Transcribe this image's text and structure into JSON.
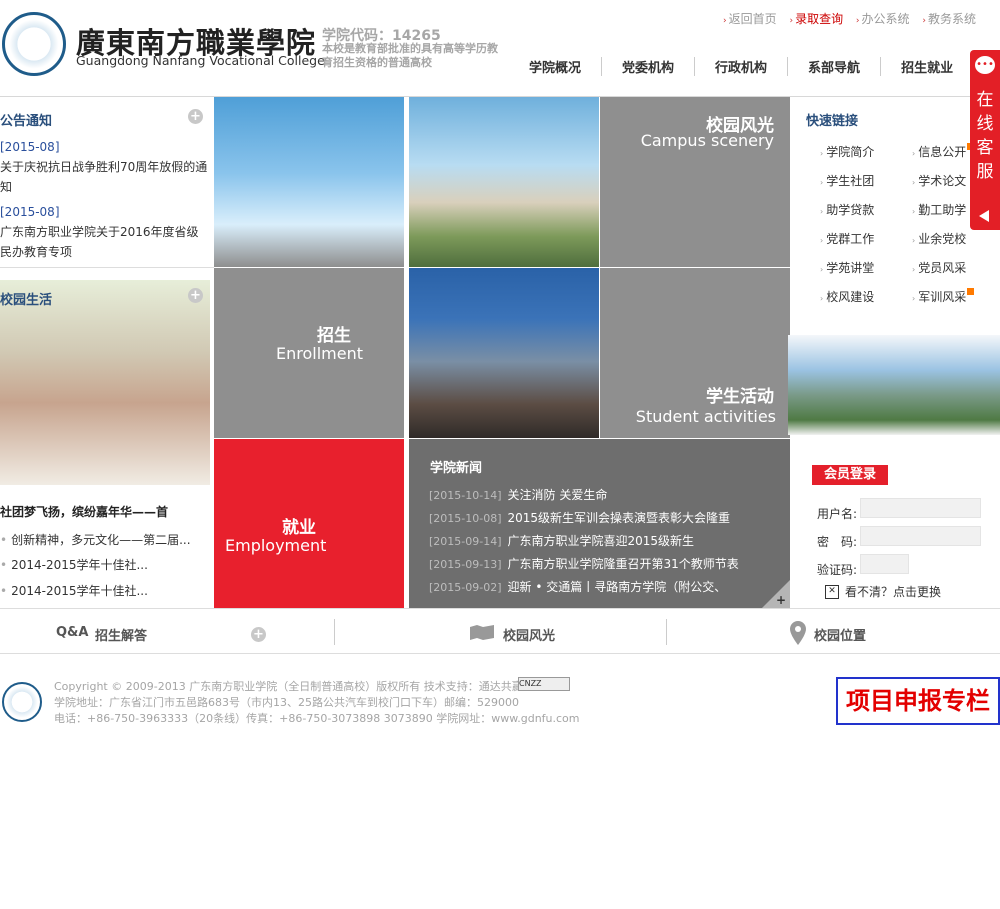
{
  "header": {
    "logo_cn": "廣東南方職業學院",
    "logo_en": "Guangdong Nanfang Vocational College",
    "school_code": "学院代码：14265",
    "school_desc": "本校是教育部批准的具有高等学历教育招生资格的普通高校",
    "top_links": [
      "返回首页",
      "录取查询",
      "办公系统",
      "教务系统"
    ],
    "nav": [
      "学院概况",
      "党委机构",
      "行政机构",
      "系部导航",
      "招生就业"
    ]
  },
  "notice": {
    "title": "公告通知",
    "items": [
      {
        "date": "[2015-08]",
        "text": "关于庆祝抗日战争胜利70周年放假的通知"
      },
      {
        "date": "[2015-08]",
        "text": "广东南方职业学院关于2016年度省级民办教育专项"
      }
    ]
  },
  "life": {
    "title": "校园生活",
    "headline": "社团梦飞扬，缤纷嘉年华——首",
    "items": [
      "创新精神，多元文化——第二届...",
      "2014-2015学年十佳社...",
      "2014-2015学年十佳社..."
    ]
  },
  "tiles": {
    "scenery_cn": "校园风光",
    "scenery_en": "Campus scenery",
    "enroll_cn": "招生",
    "enroll_en": "Enrollment",
    "activities_cn": "学生活动",
    "activities_en": "Student activities",
    "employ_cn": "就业",
    "employ_en": "Employment"
  },
  "news": {
    "title": "学院新闻",
    "items": [
      {
        "date": "[2015-10-14]",
        "text": "关注消防 关爱生命"
      },
      {
        "date": "[2015-10-08]",
        "text": "2015级新生军训会操表演暨表彰大会隆重"
      },
      {
        "date": "[2015-09-14]",
        "text": "广东南方职业学院喜迎2015级新生"
      },
      {
        "date": "[2015-09-13]",
        "text": "广东南方职业学院隆重召开第31个教师节表"
      },
      {
        "date": "[2015-09-02]",
        "text": "迎新 • 交通篇丨寻路南方学院（附公交、"
      }
    ]
  },
  "quick_links": {
    "title": "快速链接",
    "left": [
      "学院简介",
      "学生社团",
      "助学贷款",
      "党群工作",
      "学苑讲堂",
      "校风建设"
    ],
    "right": [
      "信息公开",
      "学术论文",
      "勤工助学",
      "业余党校",
      "党员风采",
      "军训风采"
    ]
  },
  "login": {
    "title": "会员登录",
    "username_label": "用户名:",
    "password_label": "密　码:",
    "captcha_label": "验证码:",
    "captcha_hint": "看不清？点击更换"
  },
  "bottom_bar": {
    "qa_prefix": "Q&A",
    "qa_label": "招生解答",
    "scenery_label": "校园风光",
    "location_label": "校园位置"
  },
  "footer": {
    "copyright": "Copyright © 2009-2013 广东南方职业学院（全日制普通高校）版权所有 技术支持：通达共赢",
    "address": "学院地址：广东省江门市五邑路683号（市内13、25路公共汽车到校门口下车）邮编：529000",
    "phone": "电话：+86-750-3963333（20条线）传真：+86-750-3073898 3073890 学院网址：www.gdnfu.com",
    "cnzz": "CNZZ",
    "project_box": "项目申报专栏"
  },
  "float_service": {
    "label": "在线客服"
  },
  "colors": {
    "accent_red": "#e8202d",
    "tile_gray": "#8f8f8f",
    "news_gray": "#6e6e6e",
    "title_blue": "#2a4f7c"
  }
}
